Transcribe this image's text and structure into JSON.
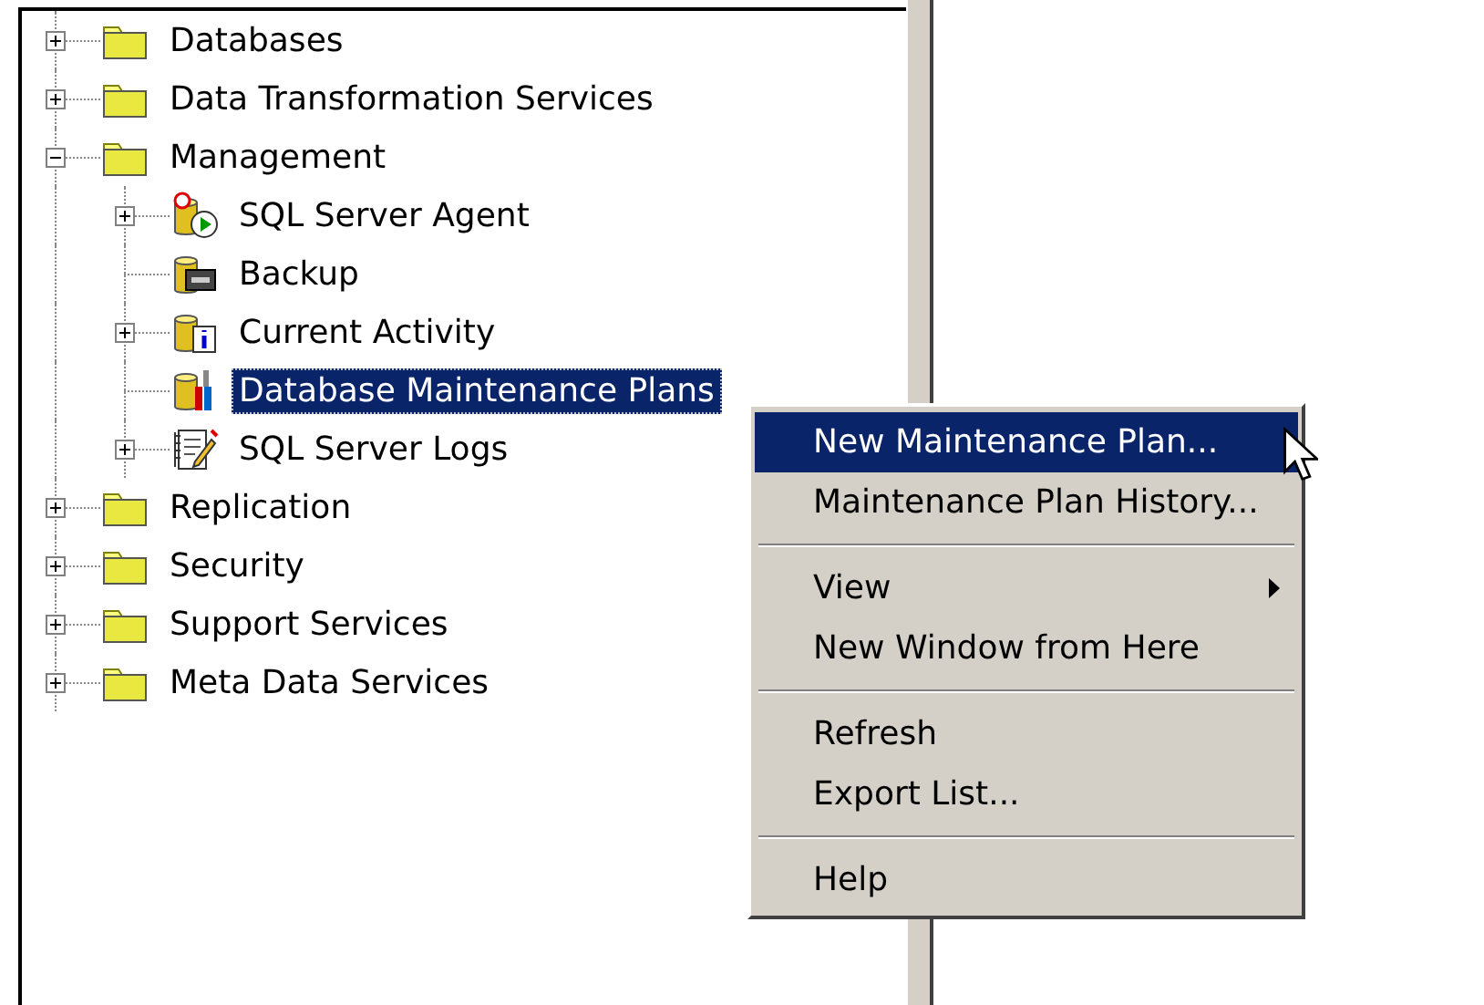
{
  "tree": [
    {
      "label": "Databases",
      "kind": "folder",
      "expanded": false,
      "selected": false
    },
    {
      "label": "Data Transformation Services",
      "kind": "folder",
      "expanded": false,
      "selected": false
    },
    {
      "label": "Management",
      "kind": "folder",
      "expanded": true,
      "selected": false,
      "children": [
        {
          "label": "SQL Server Agent",
          "kind": "agent",
          "expanded": false,
          "selected": false
        },
        {
          "label": "Backup",
          "kind": "backup",
          "selected": false
        },
        {
          "label": "Current Activity",
          "kind": "activity",
          "expanded": false,
          "selected": false
        },
        {
          "label": "Database Maintenance Plans",
          "kind": "maintenance",
          "selected": true
        },
        {
          "label": "SQL Server Logs",
          "kind": "logs",
          "expanded": false,
          "selected": false
        }
      ]
    },
    {
      "label": "Replication",
      "kind": "folder",
      "expanded": false,
      "selected": false
    },
    {
      "label": "Security",
      "kind": "folder",
      "expanded": false,
      "selected": false
    },
    {
      "label": "Support Services",
      "kind": "folder",
      "expanded": false,
      "selected": false
    },
    {
      "label": "Meta Data Services",
      "kind": "folder",
      "expanded": false,
      "selected": false
    }
  ],
  "context_menu": [
    {
      "kind": "item",
      "label": "New Maintenance Plan...",
      "selected": true,
      "submenu": false
    },
    {
      "kind": "item",
      "label": "Maintenance Plan History...",
      "selected": false,
      "submenu": false
    },
    {
      "kind": "separator"
    },
    {
      "kind": "item",
      "label": "View",
      "selected": false,
      "submenu": true
    },
    {
      "kind": "item",
      "label": "New Window from Here",
      "selected": false,
      "submenu": false
    },
    {
      "kind": "separator"
    },
    {
      "kind": "item",
      "label": "Refresh",
      "selected": false,
      "submenu": false
    },
    {
      "kind": "item",
      "label": "Export List...",
      "selected": false,
      "submenu": false
    },
    {
      "kind": "separator"
    },
    {
      "kind": "item",
      "label": "Help",
      "selected": false,
      "submenu": false
    }
  ]
}
